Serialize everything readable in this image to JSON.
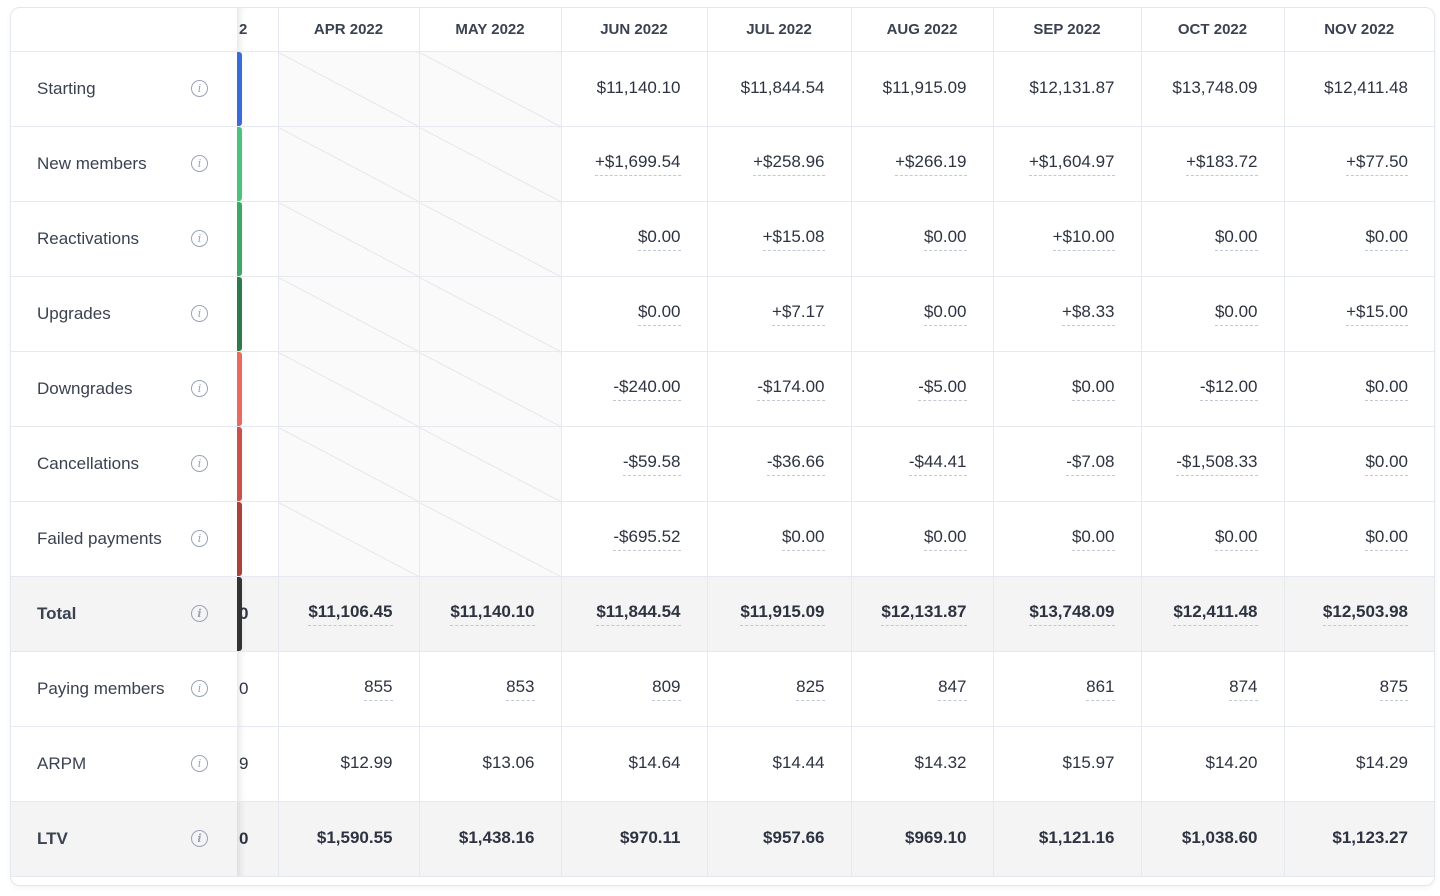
{
  "columns": {
    "partial_header": "2",
    "months": [
      "APR 2022",
      "MAY 2022",
      "JUN 2022",
      "JUL 2022",
      "AUG 2022",
      "SEP 2022",
      "OCT 2022",
      "NOV 2022"
    ]
  },
  "rows": [
    {
      "label": "Starting",
      "color": "#3b6bd6",
      "underline": false,
      "partial": "",
      "values": [
        "",
        "",
        "$11,140.10",
        "$11,844.54",
        "$11,915.09",
        "$12,131.87",
        "$13,748.09",
        "$12,411.48"
      ]
    },
    {
      "label": "New members",
      "color": "#4cc27a",
      "underline": true,
      "partial": "",
      "values": [
        "",
        "",
        "+$1,699.54",
        "+$258.96",
        "+$266.19",
        "+$1,604.97",
        "+$183.72",
        "+$77.50"
      ]
    },
    {
      "label": "Reactivations",
      "color": "#3aa866",
      "underline": true,
      "partial": "",
      "values": [
        "",
        "",
        "$0.00",
        "+$15.08",
        "$0.00",
        "+$10.00",
        "$0.00",
        "$0.00"
      ]
    },
    {
      "label": "Upgrades",
      "color": "#2e7a4c",
      "underline": true,
      "partial": "",
      "values": [
        "",
        "",
        "$0.00",
        "+$7.17",
        "$0.00",
        "+$8.33",
        "$0.00",
        "+$15.00"
      ]
    },
    {
      "label": "Downgrades",
      "color": "#e86a60",
      "underline": true,
      "partial": "",
      "values": [
        "",
        "",
        "-$240.00",
        "-$174.00",
        "-$5.00",
        "$0.00",
        "-$12.00",
        "$0.00"
      ]
    },
    {
      "label": "Cancellations",
      "color": "#c8524b",
      "underline": true,
      "partial": "",
      "values": [
        "",
        "",
        "-$59.58",
        "-$36.66",
        "-$44.41",
        "-$7.08",
        "-$1,508.33",
        "$0.00"
      ]
    },
    {
      "label": "Failed payments",
      "color": "#a8423b",
      "underline": true,
      "partial": "",
      "values": [
        "",
        "",
        "-$695.52",
        "$0.00",
        "$0.00",
        "$0.00",
        "$0.00",
        "$0.00"
      ]
    },
    {
      "label": "Total",
      "color": "#333333",
      "underline": true,
      "bold": true,
      "shade": true,
      "partial": "0",
      "values": [
        "$11,106.45",
        "$11,140.10",
        "$11,844.54",
        "$11,915.09",
        "$12,131.87",
        "$13,748.09",
        "$12,411.48",
        "$12,503.98"
      ]
    },
    {
      "label": "Paying members",
      "underline": true,
      "partial": "0",
      "values": [
        "855",
        "853",
        "809",
        "825",
        "847",
        "861",
        "874",
        "875"
      ]
    },
    {
      "label": "ARPM",
      "underline": false,
      "partial": "9",
      "values": [
        "$12.99",
        "$13.06",
        "$14.64",
        "$14.44",
        "$14.32",
        "$15.97",
        "$14.20",
        "$14.29"
      ]
    },
    {
      "label": "LTV",
      "underline": false,
      "bold": true,
      "shade": true,
      "partial": "0",
      "values": [
        "$1,590.55",
        "$1,438.16",
        "$970.11",
        "$957.66",
        "$969.10",
        "$1,121.16",
        "$1,038.60",
        "$1,123.27"
      ]
    }
  ],
  "icons": {
    "info": "info-circle-icon"
  }
}
